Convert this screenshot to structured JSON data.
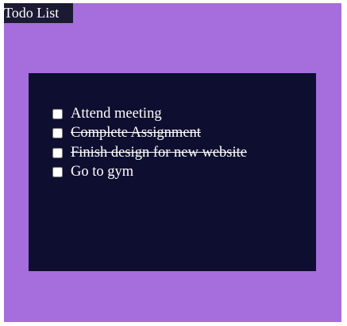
{
  "header": {
    "title": "Todo List"
  },
  "todos": [
    {
      "label": "Attend meeting",
      "checked": false,
      "done": false
    },
    {
      "label": "Complete Assignment",
      "checked": false,
      "done": true
    },
    {
      "label": "Finish design for new website",
      "checked": false,
      "done": true
    },
    {
      "label": "Go to gym",
      "checked": false,
      "done": false
    }
  ],
  "colors": {
    "background": "#a66ddd",
    "panel": "#0e0e30",
    "title_bg": "#1b1a33"
  }
}
